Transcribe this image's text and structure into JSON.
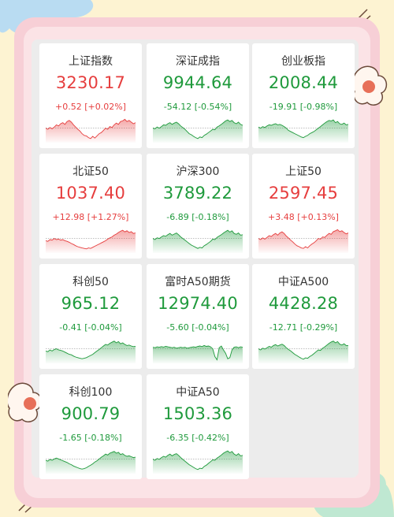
{
  "colors": {
    "up": "#e63e3e",
    "down": "#1f9a3c"
  },
  "indices": [
    {
      "name": "上证指数",
      "price": "3230.17",
      "change": "+0.52 [+0.02%]",
      "trend": "up",
      "spark": [
        0.55,
        0.5,
        0.58,
        0.52,
        0.6,
        0.7,
        0.65,
        0.75,
        0.8,
        0.72,
        0.85,
        0.9,
        0.82,
        0.7,
        0.6,
        0.5,
        0.42,
        0.3,
        0.22,
        0.2,
        0.12,
        0.08,
        0.18,
        0.1,
        0.2,
        0.3,
        0.35,
        0.45,
        0.55,
        0.5,
        0.62,
        0.58,
        0.7,
        0.78,
        0.72,
        0.85,
        0.88,
        0.95,
        0.85,
        0.9,
        0.82,
        0.75,
        0.8
      ]
    },
    {
      "name": "深证成指",
      "price": "9944.64",
      "change": "-54.12 [-0.54%]",
      "trend": "down",
      "spark": [
        0.55,
        0.52,
        0.6,
        0.55,
        0.62,
        0.7,
        0.68,
        0.75,
        0.8,
        0.72,
        0.78,
        0.82,
        0.75,
        0.65,
        0.58,
        0.5,
        0.4,
        0.3,
        0.25,
        0.18,
        0.12,
        0.08,
        0.15,
        0.12,
        0.22,
        0.28,
        0.35,
        0.42,
        0.5,
        0.48,
        0.6,
        0.65,
        0.72,
        0.8,
        0.88,
        0.92,
        0.85,
        0.9,
        0.8,
        0.75,
        0.82,
        0.72,
        0.68
      ]
    },
    {
      "name": "创业板指",
      "price": "2008.44",
      "change": "-19.91 [-0.98%]",
      "trend": "down",
      "spark": [
        0.6,
        0.55,
        0.62,
        0.58,
        0.65,
        0.7,
        0.68,
        0.72,
        0.75,
        0.7,
        0.72,
        0.68,
        0.62,
        0.55,
        0.45,
        0.4,
        0.35,
        0.3,
        0.25,
        0.2,
        0.15,
        0.12,
        0.18,
        0.22,
        0.3,
        0.35,
        0.4,
        0.48,
        0.55,
        0.62,
        0.7,
        0.78,
        0.85,
        0.9,
        0.88,
        0.92,
        0.8,
        0.85,
        0.75,
        0.72,
        0.78,
        0.7,
        0.72
      ]
    },
    {
      "name": "北证50",
      "price": "1037.40",
      "change": "+12.98 [+1.27%]",
      "trend": "up",
      "spark": [
        0.45,
        0.42,
        0.5,
        0.48,
        0.55,
        0.5,
        0.52,
        0.48,
        0.5,
        0.45,
        0.42,
        0.38,
        0.32,
        0.28,
        0.22,
        0.18,
        0.15,
        0.12,
        0.1,
        0.08,
        0.12,
        0.1,
        0.15,
        0.2,
        0.25,
        0.3,
        0.35,
        0.4,
        0.45,
        0.52,
        0.58,
        0.62,
        0.7,
        0.75,
        0.82,
        0.88,
        0.92,
        0.85,
        0.9,
        0.82,
        0.86,
        0.78,
        0.8
      ]
    },
    {
      "name": "沪深300",
      "price": "3789.22",
      "change": "-6.89 [-0.18%]",
      "trend": "down",
      "spark": [
        0.55,
        0.5,
        0.58,
        0.55,
        0.62,
        0.68,
        0.65,
        0.72,
        0.78,
        0.7,
        0.75,
        0.8,
        0.72,
        0.62,
        0.55,
        0.48,
        0.4,
        0.32,
        0.25,
        0.2,
        0.15,
        0.1,
        0.15,
        0.12,
        0.22,
        0.28,
        0.35,
        0.42,
        0.52,
        0.5,
        0.6,
        0.66,
        0.72,
        0.8,
        0.86,
        0.92,
        0.84,
        0.9,
        0.78,
        0.74,
        0.8,
        0.7,
        0.72
      ]
    },
    {
      "name": "上证50",
      "price": "2597.45",
      "change": "+3.48 [+0.13%]",
      "trend": "up",
      "spark": [
        0.55,
        0.5,
        0.58,
        0.52,
        0.6,
        0.68,
        0.64,
        0.72,
        0.78,
        0.7,
        0.8,
        0.85,
        0.78,
        0.66,
        0.58,
        0.48,
        0.4,
        0.3,
        0.22,
        0.18,
        0.12,
        0.1,
        0.18,
        0.12,
        0.22,
        0.3,
        0.36,
        0.45,
        0.55,
        0.52,
        0.62,
        0.6,
        0.7,
        0.78,
        0.74,
        0.86,
        0.9,
        0.95,
        0.86,
        0.9,
        0.82,
        0.76,
        0.8
      ]
    },
    {
      "name": "科创50",
      "price": "965.12",
      "change": "-0.41 [-0.04%]",
      "trend": "down",
      "spark": [
        0.45,
        0.42,
        0.5,
        0.45,
        0.52,
        0.55,
        0.5,
        0.48,
        0.45,
        0.4,
        0.35,
        0.3,
        0.28,
        0.22,
        0.18,
        0.15,
        0.12,
        0.1,
        0.12,
        0.15,
        0.2,
        0.25,
        0.3,
        0.38,
        0.45,
        0.52,
        0.6,
        0.68,
        0.75,
        0.72,
        0.8,
        0.85,
        0.9,
        0.82,
        0.88,
        0.78,
        0.82,
        0.75,
        0.7,
        0.72,
        0.68,
        0.65,
        0.66
      ]
    },
    {
      "name": "富时A50期货",
      "price": "12974.40",
      "change": "-5.60 [-0.04%]",
      "trend": "down",
      "spark": [
        0.62,
        0.6,
        0.64,
        0.62,
        0.65,
        0.63,
        0.66,
        0.64,
        0.62,
        0.6,
        0.62,
        0.58,
        0.6,
        0.62,
        0.6,
        0.62,
        0.58,
        0.6,
        0.62,
        0.64,
        0.62,
        0.66,
        0.68,
        0.65,
        0.7,
        0.66,
        0.68,
        0.64,
        0.55,
        0.2,
        0.05,
        0.6,
        0.68,
        0.5,
        0.35,
        0.1,
        0.15,
        0.5,
        0.62,
        0.64,
        0.6,
        0.64,
        0.62
      ]
    },
    {
      "name": "中证A500",
      "price": "4428.28",
      "change": "-12.71 [-0.29%]",
      "trend": "down",
      "spark": [
        0.55,
        0.5,
        0.58,
        0.54,
        0.6,
        0.66,
        0.62,
        0.7,
        0.74,
        0.68,
        0.72,
        0.76,
        0.7,
        0.6,
        0.52,
        0.46,
        0.38,
        0.3,
        0.24,
        0.18,
        0.12,
        0.08,
        0.14,
        0.12,
        0.2,
        0.26,
        0.34,
        0.42,
        0.5,
        0.48,
        0.58,
        0.64,
        0.72,
        0.8,
        0.86,
        0.9,
        0.82,
        0.88,
        0.76,
        0.72,
        0.78,
        0.7,
        0.7
      ]
    },
    {
      "name": "科创100",
      "price": "900.79",
      "change": "-1.65 [-0.18%]",
      "trend": "down",
      "spark": [
        0.5,
        0.46,
        0.54,
        0.5,
        0.56,
        0.6,
        0.56,
        0.52,
        0.48,
        0.44,
        0.4,
        0.34,
        0.3,
        0.24,
        0.2,
        0.16,
        0.12,
        0.1,
        0.12,
        0.16,
        0.22,
        0.28,
        0.34,
        0.42,
        0.48,
        0.56,
        0.64,
        0.7,
        0.78,
        0.74,
        0.82,
        0.86,
        0.9,
        0.82,
        0.86,
        0.76,
        0.8,
        0.72,
        0.68,
        0.7,
        0.66,
        0.62,
        0.64
      ]
    },
    {
      "name": "中证A50",
      "price": "1503.36",
      "change": "-6.35 [-0.42%]",
      "trend": "down",
      "spark": [
        0.55,
        0.5,
        0.58,
        0.54,
        0.62,
        0.68,
        0.64,
        0.72,
        0.78,
        0.7,
        0.76,
        0.8,
        0.72,
        0.62,
        0.54,
        0.46,
        0.38,
        0.3,
        0.24,
        0.18,
        0.12,
        0.08,
        0.14,
        0.12,
        0.22,
        0.28,
        0.36,
        0.44,
        0.52,
        0.5,
        0.6,
        0.66,
        0.74,
        0.82,
        0.88,
        0.92,
        0.84,
        0.9,
        0.78,
        0.72,
        0.8,
        0.7,
        0.72
      ]
    }
  ]
}
